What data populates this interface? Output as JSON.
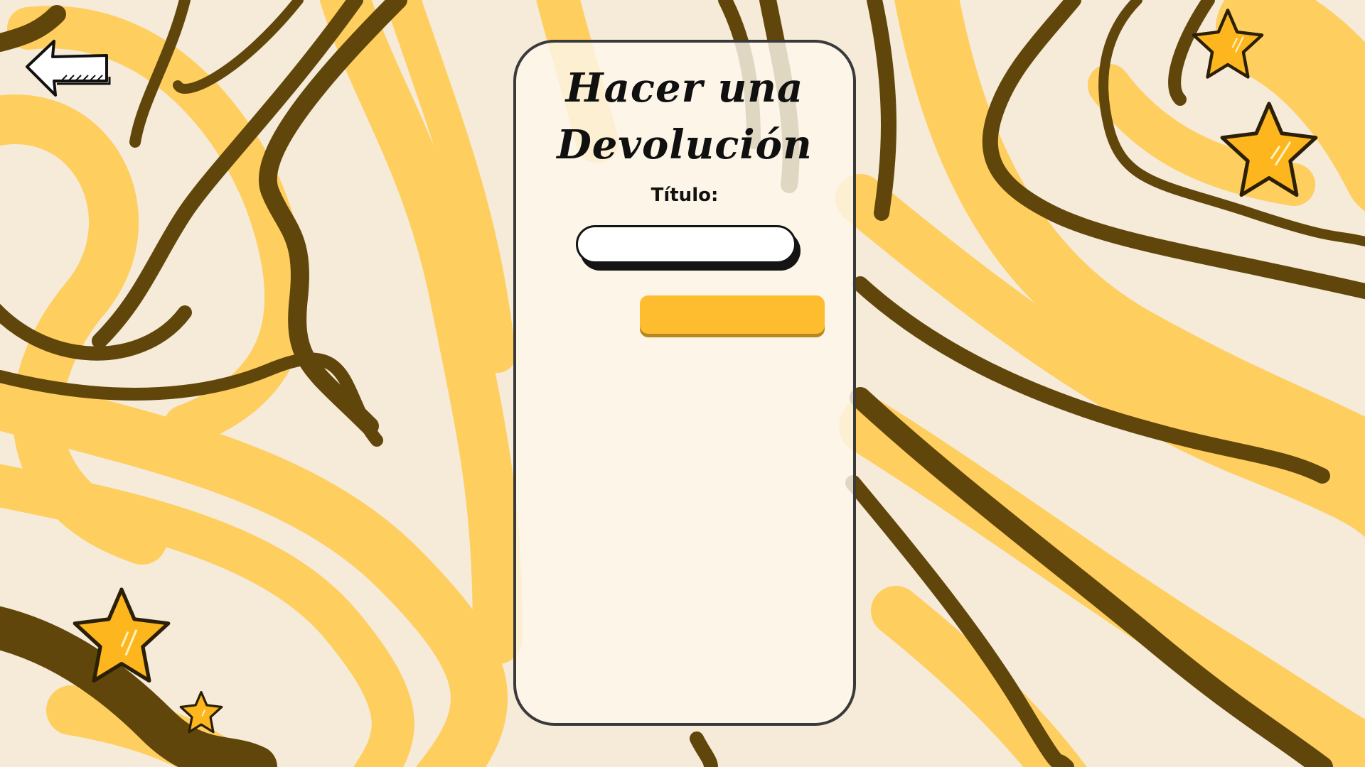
{
  "page": {
    "title_line1": "Hacer una",
    "title_line2": "Devolución"
  },
  "form": {
    "title_label": "Título:",
    "title_value": "",
    "title_placeholder": "",
    "submit_label": ""
  },
  "icons": {
    "back": "left-arrow-icon",
    "decoration": "star-icon"
  },
  "colors": {
    "background": "#f6ead8",
    "swirl_yellow": "#fece5e",
    "swirl_brown": "#61460b",
    "star": "#fdb61d",
    "button": "#fdbd2f"
  }
}
